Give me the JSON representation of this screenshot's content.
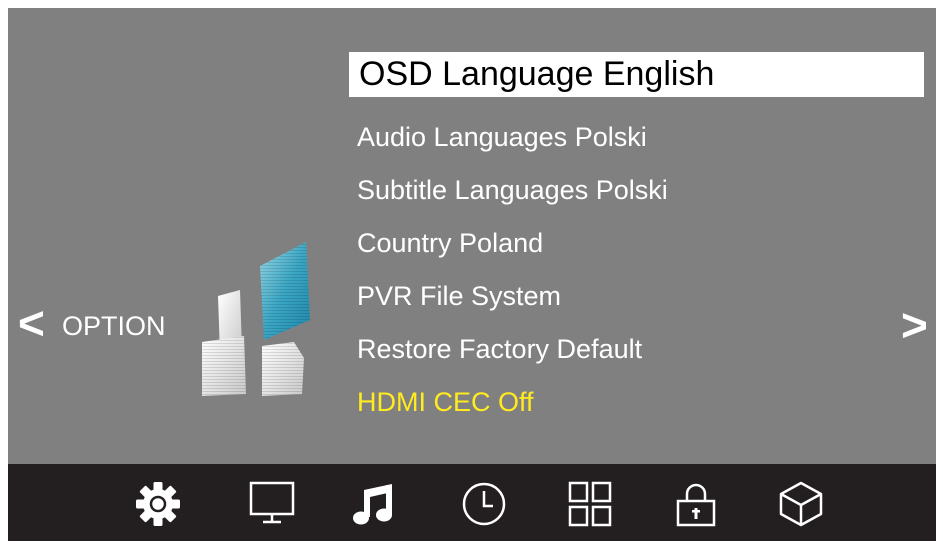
{
  "nav": {
    "left_arrow": "<",
    "right_arrow": ">",
    "section_label": "OPTION"
  },
  "menu": {
    "items": [
      {
        "label": "OSD Language English",
        "state": "selected"
      },
      {
        "label": "Audio Languages Polski",
        "state": "normal"
      },
      {
        "label": "Subtitle Languages Polski",
        "state": "normal"
      },
      {
        "label": "Country Poland",
        "state": "normal"
      },
      {
        "label": "PVR File System",
        "state": "normal"
      },
      {
        "label": "Restore Factory Default",
        "state": "normal"
      },
      {
        "label": "HDMI CEC Off",
        "state": "highlight"
      }
    ]
  },
  "tabs": [
    {
      "icon": "gear-icon",
      "name": "settings",
      "active": true
    },
    {
      "icon": "monitor-icon",
      "name": "picture"
    },
    {
      "icon": "music-note-icon",
      "name": "sound"
    },
    {
      "icon": "clock-icon",
      "name": "time"
    },
    {
      "icon": "grid-icon",
      "name": "channel"
    },
    {
      "icon": "lock-icon",
      "name": "lock"
    },
    {
      "icon": "cube-icon",
      "name": "app"
    }
  ],
  "colors": {
    "background": "#808080",
    "bottom_bar": "#231f20",
    "text": "#ffffff",
    "selected_bg": "#ffffff",
    "selected_text": "#000000",
    "highlight_text": "#ffeb1f"
  }
}
